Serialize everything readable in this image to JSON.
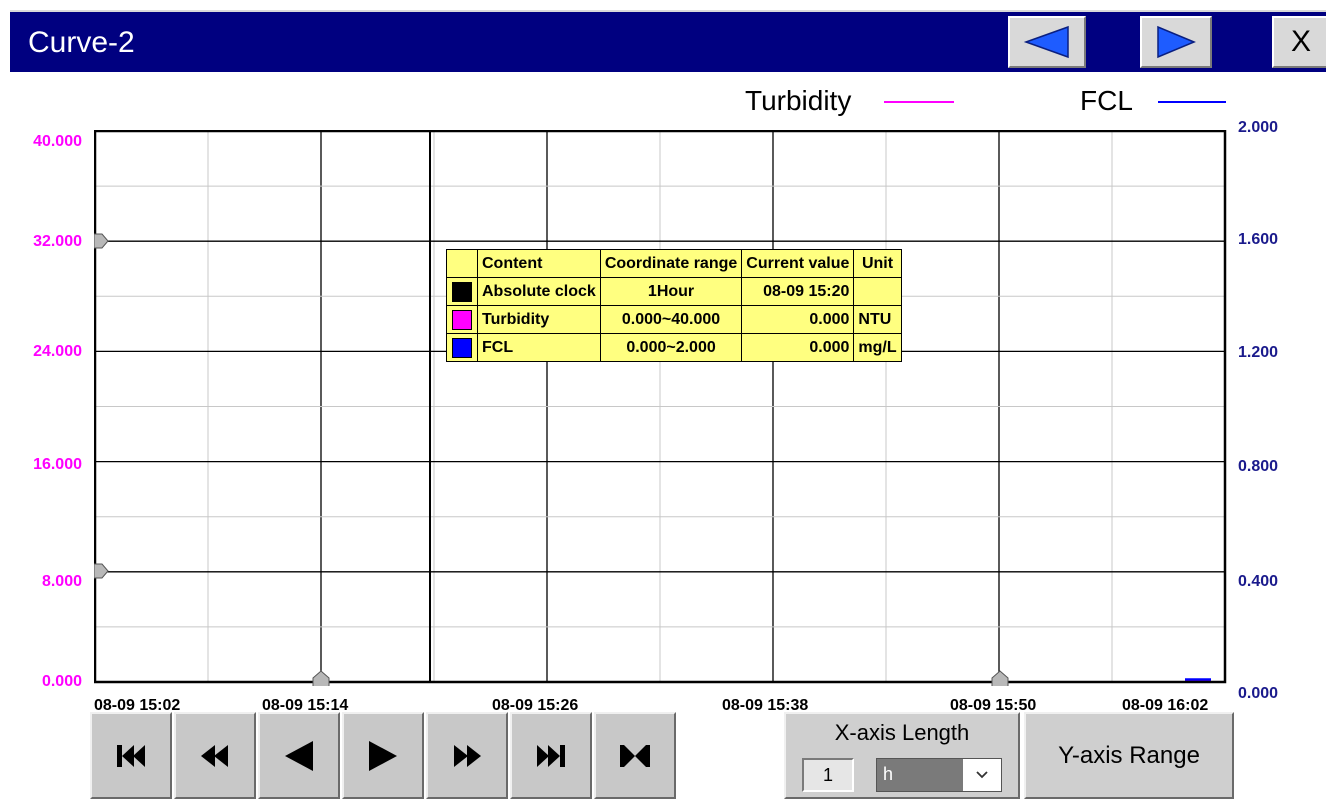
{
  "window": {
    "title": "Curve-2",
    "close_label": "X"
  },
  "colors": {
    "title_bar": "#000080",
    "turbidity": "#ff00ff",
    "fcl": "#0000ff",
    "info_bg": "#ffff80",
    "grid": "#c8c8c8",
    "grid_major": "#000000",
    "right_axis_text": "#1a1a8c"
  },
  "legend": [
    {
      "label": "Turbidity",
      "color": "#ff00ff"
    },
    {
      "label": "FCL",
      "color": "#0000ff"
    }
  ],
  "info_table": {
    "headers": [
      "Content",
      "Coordinate range",
      "Current value",
      "Unit"
    ],
    "rows": [
      {
        "swatch": "#000000",
        "content": "Absolute clock",
        "range": "1Hour",
        "value": "08-09 15:20",
        "unit": ""
      },
      {
        "swatch": "#ff00ff",
        "content": "Turbidity",
        "range": "0.000~40.000",
        "value": "0.000",
        "unit": "NTU"
      },
      {
        "swatch": "#0000ff",
        "content": "FCL",
        "range": "0.000~2.000",
        "value": "0.000",
        "unit": "mg/L"
      }
    ]
  },
  "chart_data": {
    "type": "line",
    "title": "",
    "x_ticks": [
      "08-09 15:02",
      "08-09 15:14",
      "08-09 15:26",
      "08-09 15:38",
      "08-09 15:50",
      "08-09 16:02"
    ],
    "y_left": {
      "range": [
        0,
        40
      ],
      "ticks": [
        "40.000",
        "32.000",
        "24.000",
        "16.000",
        "8.000",
        "0.000"
      ]
    },
    "y_right": {
      "range": [
        0,
        2
      ],
      "ticks": [
        "2.000",
        "1.600",
        "1.200",
        "0.800",
        "0.400",
        "0.000"
      ]
    },
    "grid": true,
    "cursor_time": "08-09 15:20",
    "series": [
      {
        "name": "Turbidity",
        "color": "#ff00ff",
        "axis": "left",
        "values": [
          0.0
        ]
      },
      {
        "name": "FCL",
        "color": "#0000ff",
        "axis": "right",
        "values": [
          0.0
        ]
      }
    ]
  },
  "navigation": {
    "buttons": [
      {
        "icon": "first-page-icon"
      },
      {
        "icon": "fast-backward-icon"
      },
      {
        "icon": "step-backward-icon"
      },
      {
        "icon": "step-forward-icon"
      },
      {
        "icon": "fast-forward-icon"
      },
      {
        "icon": "last-page-icon"
      },
      {
        "icon": "expand-range-icon"
      }
    ]
  },
  "xaxis_length": {
    "label": "X-axis Length",
    "value": "1",
    "unit": "h"
  },
  "yaxis_range": {
    "label": "Y-axis Range"
  }
}
